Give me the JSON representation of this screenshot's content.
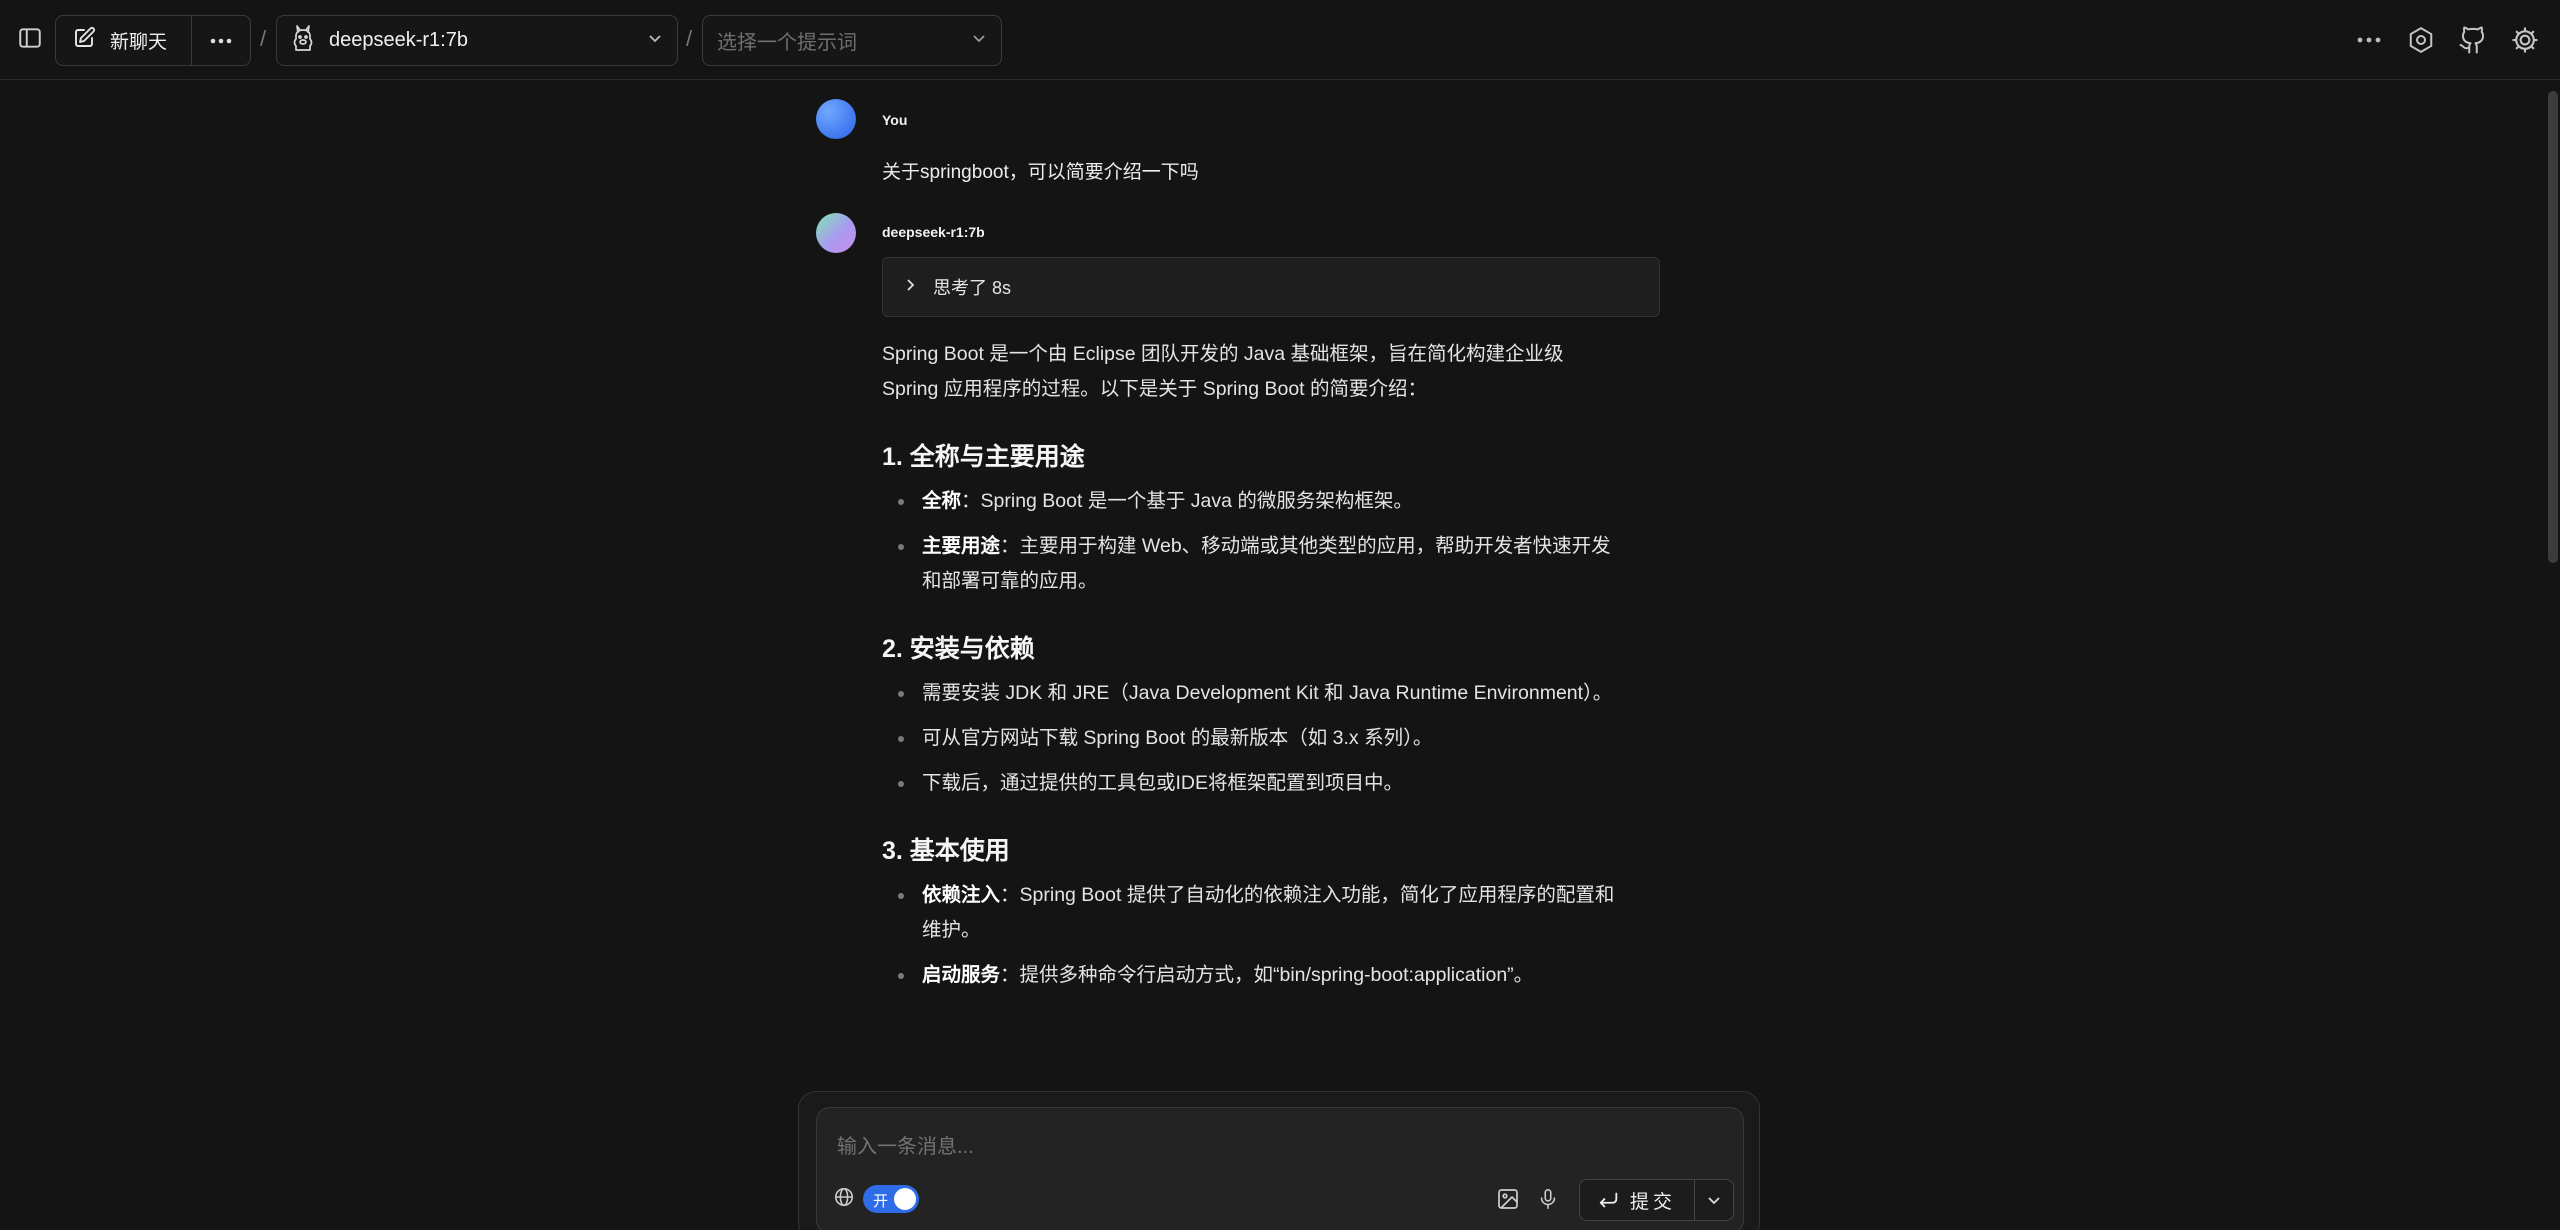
{
  "topbar": {
    "new_chat_label": "新聊天",
    "separator": "/",
    "model_label": "deepseek-r1:7b",
    "prompt_placeholder": "选择一个提示词"
  },
  "icons": {
    "sidebar": "sidebar-toggle-icon",
    "new_chat": "edit-icon",
    "more": "more-horizontal-icon",
    "model": "llama-icon",
    "chevron": "chevron-down-icon",
    "settings_a": "settings-icon",
    "github": "github-icon",
    "settings_b": "gear-icon",
    "think": "chevron-right-icon",
    "globe": "globe-icon",
    "image": "image-icon",
    "mic": "microphone-icon",
    "enter": "enter-icon"
  },
  "colors": {
    "background": "#141414",
    "accent": "#2f6de8"
  },
  "messages": {
    "user": {
      "sender": "You",
      "text": "关于springboot，可以简要介绍一下吗"
    },
    "bot": {
      "sender": "deepseek-r1:7b",
      "think_label": "思考了 8s",
      "intro": "Spring Boot 是一个由 Eclipse 团队开发的 Java 基础框架，旨在简化构建企业级 Spring 应用程序的过程。以下是关于 Spring Boot 的简要介绍：",
      "sections": [
        {
          "title": "1. 全称与主要用途",
          "items": [
            {
              "bold": "全称",
              "text": "：Spring Boot 是一个基于 Java 的微服务架构框架。"
            },
            {
              "bold": "主要用途",
              "text": "：主要用于构建 Web、移动端或其他类型的应用，帮助开发者快速开发和部署可靠的应用。"
            }
          ]
        },
        {
          "title": "2. 安装与依赖",
          "items": [
            {
              "bold": "",
              "text": "需要安装 JDK 和 JRE（Java Development Kit 和 Java Runtime Environment）。"
            },
            {
              "bold": "",
              "text": "可从官方网站下载 Spring Boot 的最新版本（如 3.x 系列）。"
            },
            {
              "bold": "",
              "text": "下载后，通过提供的工具包或IDE将框架配置到项目中。"
            }
          ]
        },
        {
          "title": "3. 基本使用",
          "items": [
            {
              "bold": "依赖注入",
              "text": "：Spring Boot 提供了自动化的依赖注入功能，简化了应用程序的配置和维护。"
            },
            {
              "bold": "启动服务",
              "text": "：提供多种命令行启动方式，如“bin/spring-boot:application”。"
            }
          ]
        }
      ]
    }
  },
  "composer": {
    "placeholder": "输入一条消息...",
    "toggle_label": "开",
    "toggle_on": true,
    "submit_label": "提交"
  }
}
